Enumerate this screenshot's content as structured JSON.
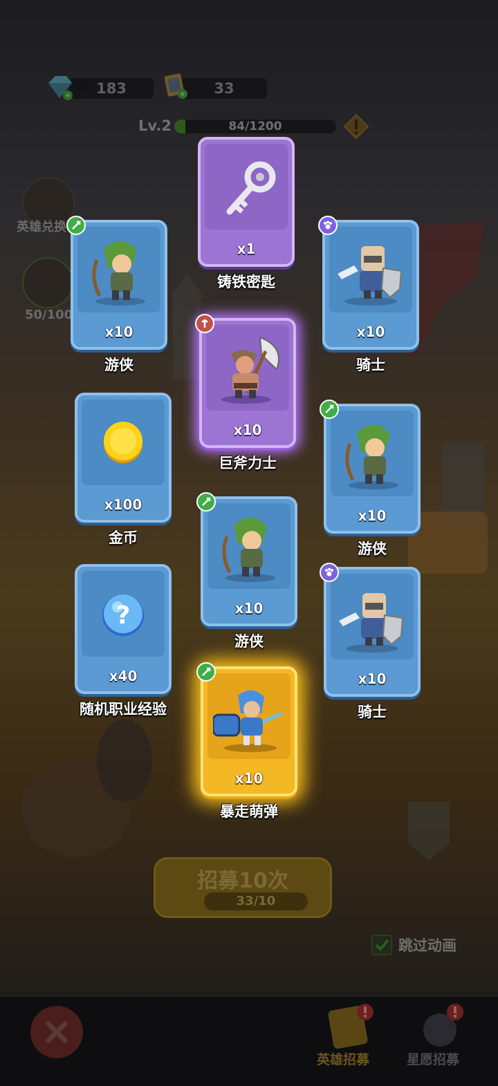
{
  "resources": {
    "gems": "183",
    "tickets": "33"
  },
  "level": {
    "label": "Lv.2",
    "xp_text": "84/1200",
    "xp_fraction": 0.07
  },
  "side": {
    "hero_exchange": "英雄兑换",
    "progress": "50/100"
  },
  "cards": [
    {
      "id": "key",
      "qty": "x1",
      "name": "铸铁密匙",
      "style": "purple",
      "badge": "none",
      "icon": "key-icon"
    },
    {
      "id": "ranger-1",
      "qty": "x10",
      "name": "游侠",
      "style": "blue",
      "badge": "green",
      "icon": "ranger-hero-icon"
    },
    {
      "id": "knight-1",
      "qty": "x10",
      "name": "骑士",
      "style": "blue",
      "badge": "purple",
      "icon": "knight-hero-icon"
    },
    {
      "id": "axe",
      "qty": "x10",
      "name": "巨斧力士",
      "style": "purple-glow",
      "badge": "red",
      "icon": "axe-warrior-hero-icon"
    },
    {
      "id": "gold",
      "qty": "x100",
      "name": "金币",
      "style": "blue",
      "badge": "none",
      "icon": "gold-coin-icon"
    },
    {
      "id": "ranger-2",
      "qty": "x10",
      "name": "游侠",
      "style": "blue",
      "badge": "green",
      "icon": "ranger-hero-icon"
    },
    {
      "id": "ranger-3",
      "qty": "x10",
      "name": "游侠",
      "style": "blue",
      "badge": "green",
      "icon": "ranger-hero-icon"
    },
    {
      "id": "exp",
      "qty": "x40",
      "name": "随机职业经验",
      "style": "blue",
      "badge": "none",
      "icon": "random-exp-icon"
    },
    {
      "id": "knight-2",
      "qty": "x10",
      "name": "骑士",
      "style": "blue",
      "badge": "purple",
      "icon": "knight-hero-icon"
    },
    {
      "id": "cannon",
      "qty": "x10",
      "name": "暴走萌弹",
      "style": "gold",
      "badge": "green",
      "icon": "cannon-hero-icon"
    }
  ],
  "recruit": {
    "title": "招募10次",
    "cost": "33/10"
  },
  "skip_animation": "跳过动画",
  "tabs": {
    "hero_recruit": "英雄招募",
    "wish_recruit": "星愿招募"
  },
  "colors": {
    "card_blue": "#5b9ad2",
    "card_purple": "#9c74d4",
    "card_gold": "#f3b823"
  }
}
